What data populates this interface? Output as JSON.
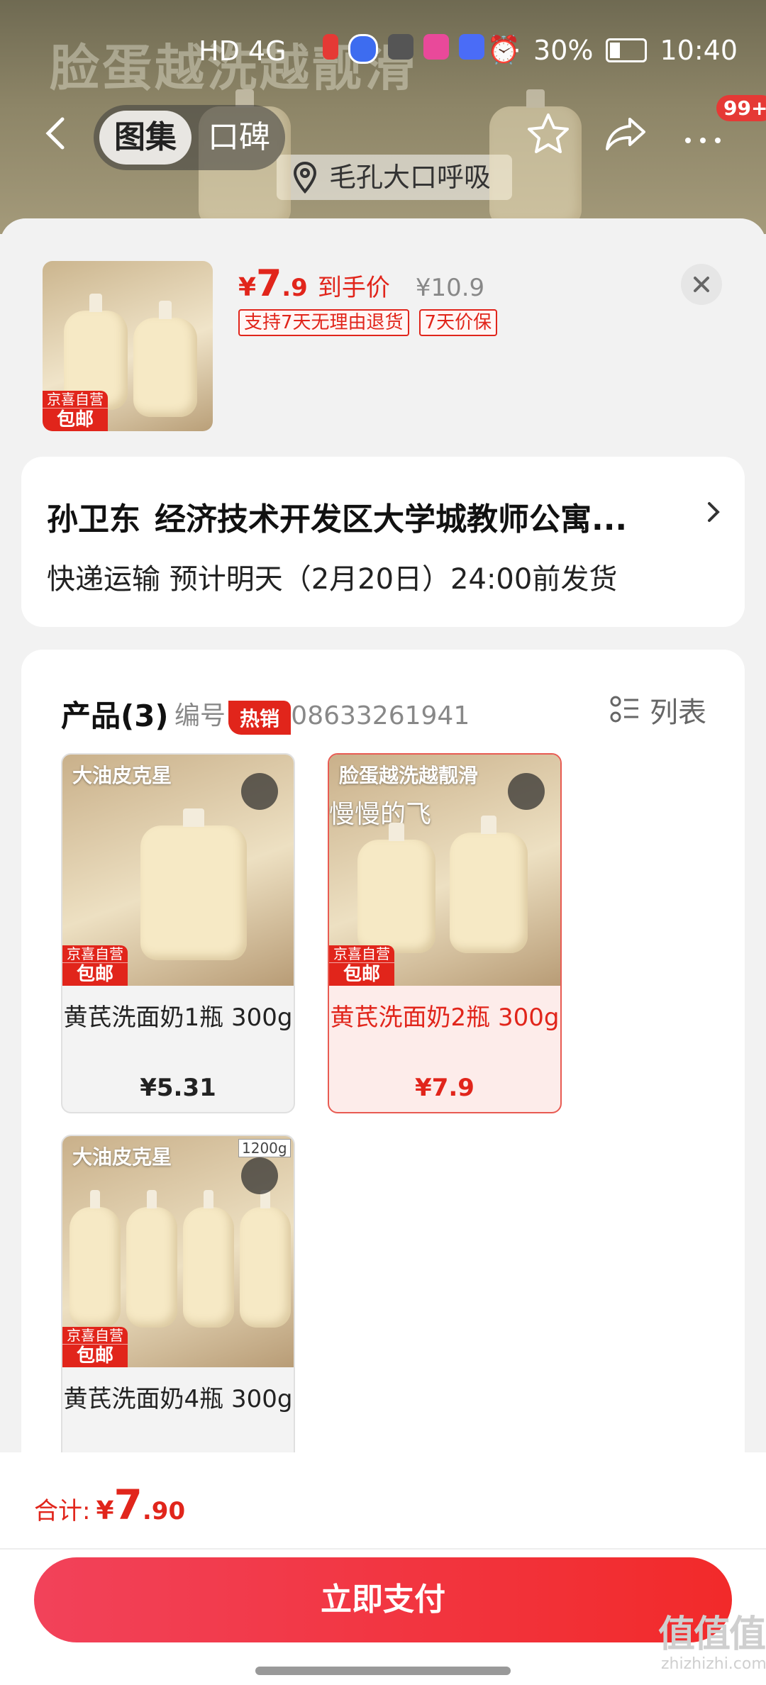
{
  "background": {
    "slogan": "脸蛋越洗越靓滑",
    "feature_tag": "毛孔大口呼吸"
  },
  "status_bar": {
    "left": "HD 4G",
    "battery": "30%",
    "time": "10:40"
  },
  "nav": {
    "tab_gallery": "图集",
    "tab_reviews": "口碑",
    "badge": "99+"
  },
  "summary": {
    "price_symbol": "¥",
    "price_int": "7",
    "price_dec": ".9",
    "price_label": "到手价",
    "original_price": "¥10.9",
    "tags": [
      "支持7天无理由退货",
      "7天价保"
    ],
    "thumb_badge_top": "京喜自营",
    "thumb_badge_bottom": "包邮"
  },
  "address": {
    "name": "孙卫东",
    "detail": "经济技术开发区大学城教师公寓...",
    "shipping": "快递运输 预计明天（2月20日）24:00前发货"
  },
  "products": {
    "title": "产品(3)",
    "code": "编号: 10108633261941",
    "view_mode": "列表",
    "items": [
      {
        "name": "黄芪洗面奶1瓶 300g",
        "price": "¥5.31",
        "hot": "热销",
        "slogan": "大油皮克星",
        "badge_top": "京喜自营",
        "badge_bottom": "包邮"
      },
      {
        "name": "黄芪洗面奶2瓶 300g",
        "price": "¥7.9",
        "slogan": "脸蛋越洗越靓滑",
        "overlay": "慢慢的飞",
        "badge_top": "京喜自营",
        "badge_bottom": "包邮"
      },
      {
        "name": "黄芪洗面奶4瓶 300g",
        "slogan": "大油皮克星",
        "size_tag": "1200g",
        "badge_top": "京喜自营",
        "badge_bottom": "包邮"
      }
    ]
  },
  "footer": {
    "total_label": "合计:",
    "total_symbol": "¥",
    "total_int": "7",
    "total_dec": ".90",
    "pay_button": "立即支付"
  },
  "watermark": {
    "main": "值值值",
    "sub": "zhizhizhi.com"
  },
  "colors": {
    "accent": "#e1251b",
    "pay_gradient_start": "#f2425a",
    "pay_gradient_end": "#f22a2a"
  }
}
